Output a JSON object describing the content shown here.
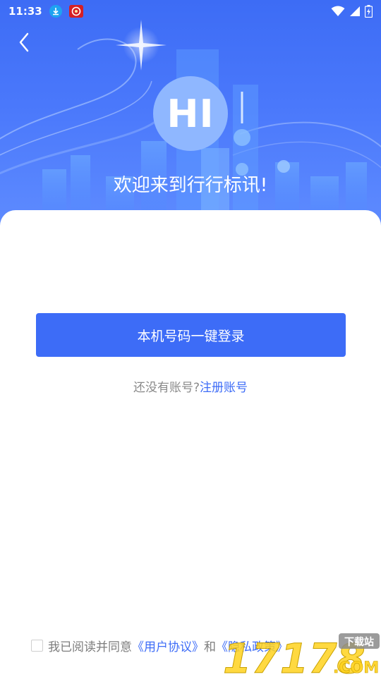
{
  "status_bar": {
    "time": "11:33",
    "icons": [
      "download-notification-icon",
      "app-notification-icon",
      "wifi-icon",
      "signal-icon",
      "battery-icon"
    ]
  },
  "header": {
    "back_icon": "chevron-left-icon",
    "avatar_text": "HI",
    "welcome": "欢迎来到行行标讯!"
  },
  "login": {
    "one_click_label": "本机号码一键登录",
    "no_account_prompt": "还没有账号?",
    "register_link": "注册账号"
  },
  "agreement": {
    "checked": false,
    "prefix": "我已阅读并同意",
    "user_agreement": "《用户协议》",
    "conjunction": "和",
    "privacy_policy": "《隐私政策》"
  },
  "watermark": {
    "brand_number": "17178",
    "domain": ".COM",
    "badge": "下载站"
  },
  "colors": {
    "primary": "#3d6cf7",
    "hero_top": "#3d6cf5",
    "avatar_bg": "#8fb7ff",
    "muted_text": "#8a8a8a"
  }
}
